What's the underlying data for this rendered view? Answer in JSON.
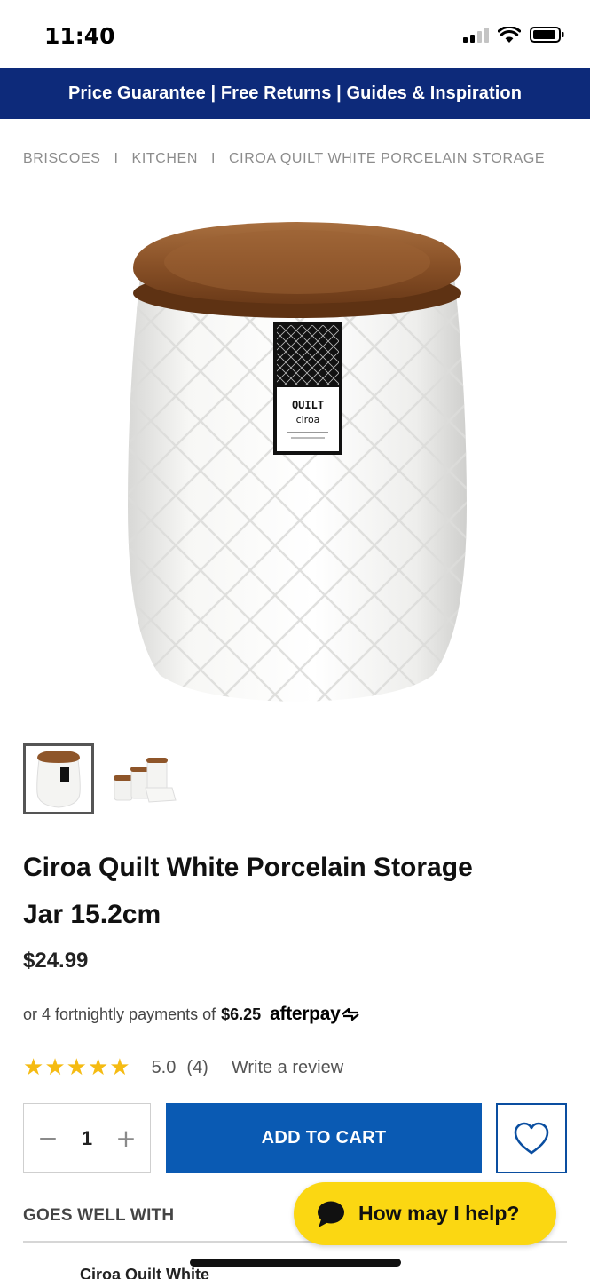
{
  "status_bar": {
    "time": "11:40",
    "icons": [
      "cellular-signal-icon",
      "wifi-icon",
      "battery-icon"
    ]
  },
  "promo_bar": {
    "text": "Price Guarantee | Free Returns | Guides & Inspiration",
    "background": "#0d2a7a"
  },
  "breadcrumb": {
    "items": [
      "BRISCOES",
      "KITCHEN",
      "CIROA QUILT WHITE PORCELAIN STORAGE"
    ],
    "separator": "I"
  },
  "product": {
    "label_brand": "QUILT",
    "label_sub": "ciroa",
    "title": "Ciroa Quilt White Porcelain Storage Jar 15.2cm",
    "price": "$24.99",
    "afterpay": {
      "prefix": "or 4 fortnightly payments of",
      "amount": "$6.25",
      "logo_text": "afterpay"
    },
    "rating": {
      "stars": 5,
      "score": "5.0",
      "count": "(4)",
      "write_review": "Write a review",
      "star_color": "#f5bb12"
    },
    "quantity": "1",
    "add_to_cart": "ADD TO CART",
    "accent_color": "#0a5ab3"
  },
  "goes_well": {
    "heading": "GOES WELL WITH",
    "next_item": "Ciroa Quilt White"
  },
  "chat": {
    "label": "How may I help?",
    "background": "#fbd712"
  }
}
